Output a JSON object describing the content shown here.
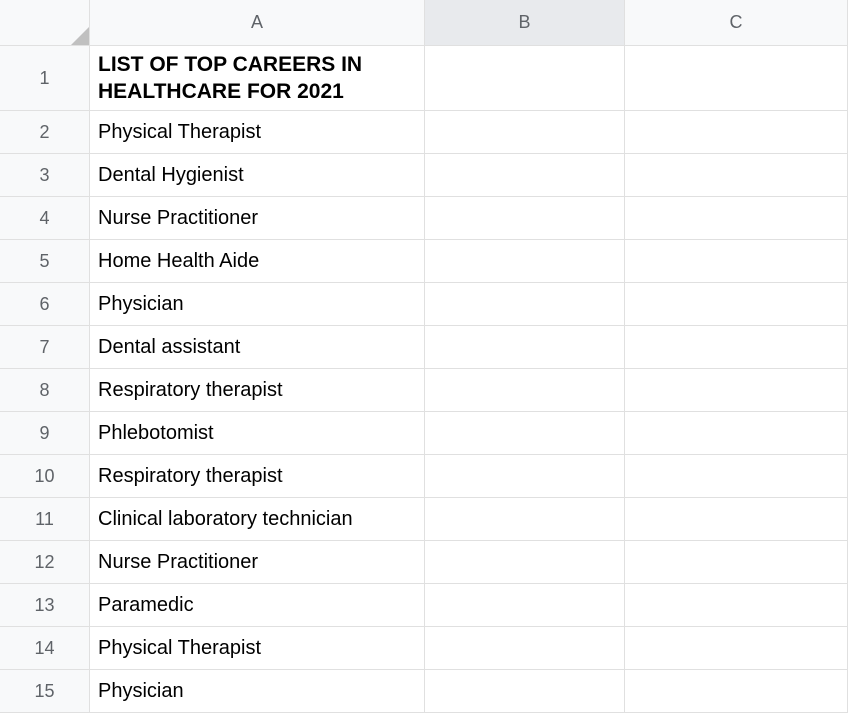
{
  "columns": [
    "A",
    "B",
    "C"
  ],
  "selected_column": "B",
  "rows": [
    {
      "num": "1",
      "a": "LIST OF TOP CAREERS IN HEALTHCARE FOR 2021",
      "b": "",
      "c": "",
      "is_title": true
    },
    {
      "num": "2",
      "a": "Physical Therapist",
      "b": "",
      "c": ""
    },
    {
      "num": "3",
      "a": "Dental Hygienist",
      "b": "",
      "c": ""
    },
    {
      "num": "4",
      "a": "Nurse Practitioner",
      "b": "",
      "c": ""
    },
    {
      "num": "5",
      "a": "Home Health Aide",
      "b": "",
      "c": ""
    },
    {
      "num": "6",
      "a": "Physician",
      "b": "",
      "c": ""
    },
    {
      "num": "7",
      "a": "Dental assistant",
      "b": "",
      "c": ""
    },
    {
      "num": "8",
      "a": "Respiratory therapist",
      "b": "",
      "c": ""
    },
    {
      "num": "9",
      "a": "Phlebotomist",
      "b": "",
      "c": ""
    },
    {
      "num": "10",
      "a": "Respiratory therapist",
      "b": "",
      "c": ""
    },
    {
      "num": "11",
      "a": "Clinical laboratory technician",
      "b": "",
      "c": ""
    },
    {
      "num": "12",
      "a": "Nurse Practitioner",
      "b": "",
      "c": ""
    },
    {
      "num": "13",
      "a": "Paramedic",
      "b": "",
      "c": ""
    },
    {
      "num": "14",
      "a": "Physical Therapist",
      "b": "",
      "c": ""
    },
    {
      "num": "15",
      "a": "Physician",
      "b": "",
      "c": ""
    }
  ]
}
